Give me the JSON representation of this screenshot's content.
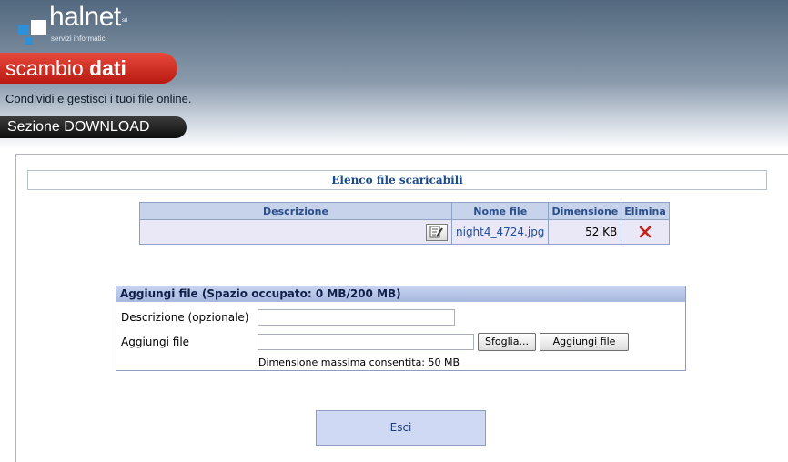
{
  "header": {
    "brand": "halnet",
    "brand_suffix": "srl",
    "brand_sub": "servizi informatici",
    "app_title_light": "scambio",
    "app_title_bold": "dati",
    "tagline": "Condividi e gestisci i tuoi file online.",
    "section": "Sezione DOWNLOAD"
  },
  "file_list": {
    "title": "Elenco file scaricabili",
    "columns": [
      "Descrizione",
      "Nome file",
      "Dimensione",
      "Elimina"
    ],
    "rows": [
      {
        "description": "",
        "filename": "night4_4724.jpg",
        "size": "52 KB"
      }
    ]
  },
  "add_file": {
    "title": "Aggiungi file (Spazio occupato: 0 MB/200 MB)",
    "description_label": "Descrizione (opzionale)",
    "description_value": "",
    "file_label": "Aggiungi file",
    "file_value": "",
    "browse_label": "Sfoglia...",
    "add_button_label": "Aggiungi file",
    "max_size_note": "Dimensione massima consentita: 50 MB"
  },
  "exit_button_label": "Esci",
  "icons": {
    "edit": "edit-note-icon",
    "delete": "delete-x-icon"
  },
  "colors": {
    "accent_red": "#c4241a",
    "table_header": "#c7d3ea",
    "table_row": "#eae7f7",
    "link_blue": "#1f4fa0"
  }
}
